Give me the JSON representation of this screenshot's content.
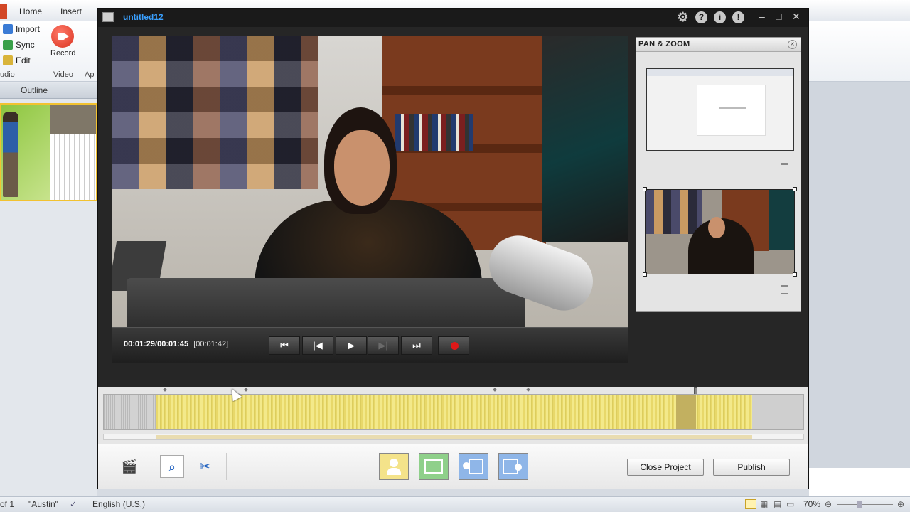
{
  "powerpoint": {
    "tabs": [
      "Home",
      "Insert"
    ],
    "ribbon": {
      "audio_items": [
        "Import",
        "Sync",
        "Edit"
      ],
      "audio_group": "udio",
      "record_label": "Record",
      "video_group": "Video",
      "app_group": "Ap"
    },
    "outline_tab": "Outline",
    "status": {
      "slide_of": "of 1",
      "theme": "\"Austin\"",
      "language": "English (U.S.)",
      "zoom": "70%"
    }
  },
  "presenter": {
    "title": "untitled12",
    "titlebar_icons": [
      "gear-icon",
      "help-icon",
      "info-icon",
      "feedback-icon"
    ],
    "controls": {
      "time_current": "00:01:29/00:01:45",
      "time_duration": "[00:01:42]",
      "buttons": [
        "rewind-to-start",
        "previous",
        "play",
        "next",
        "fast-forward",
        "record"
      ]
    },
    "pan_zoom": {
      "title": "PAN & ZOOM"
    },
    "toolbar": {
      "close_project": "Close Project",
      "publish": "Publish"
    },
    "colors": {
      "title_blue": "#3aa0ff",
      "timeline_yellow": "#f3e98a",
      "record_red": "#e01818"
    }
  }
}
